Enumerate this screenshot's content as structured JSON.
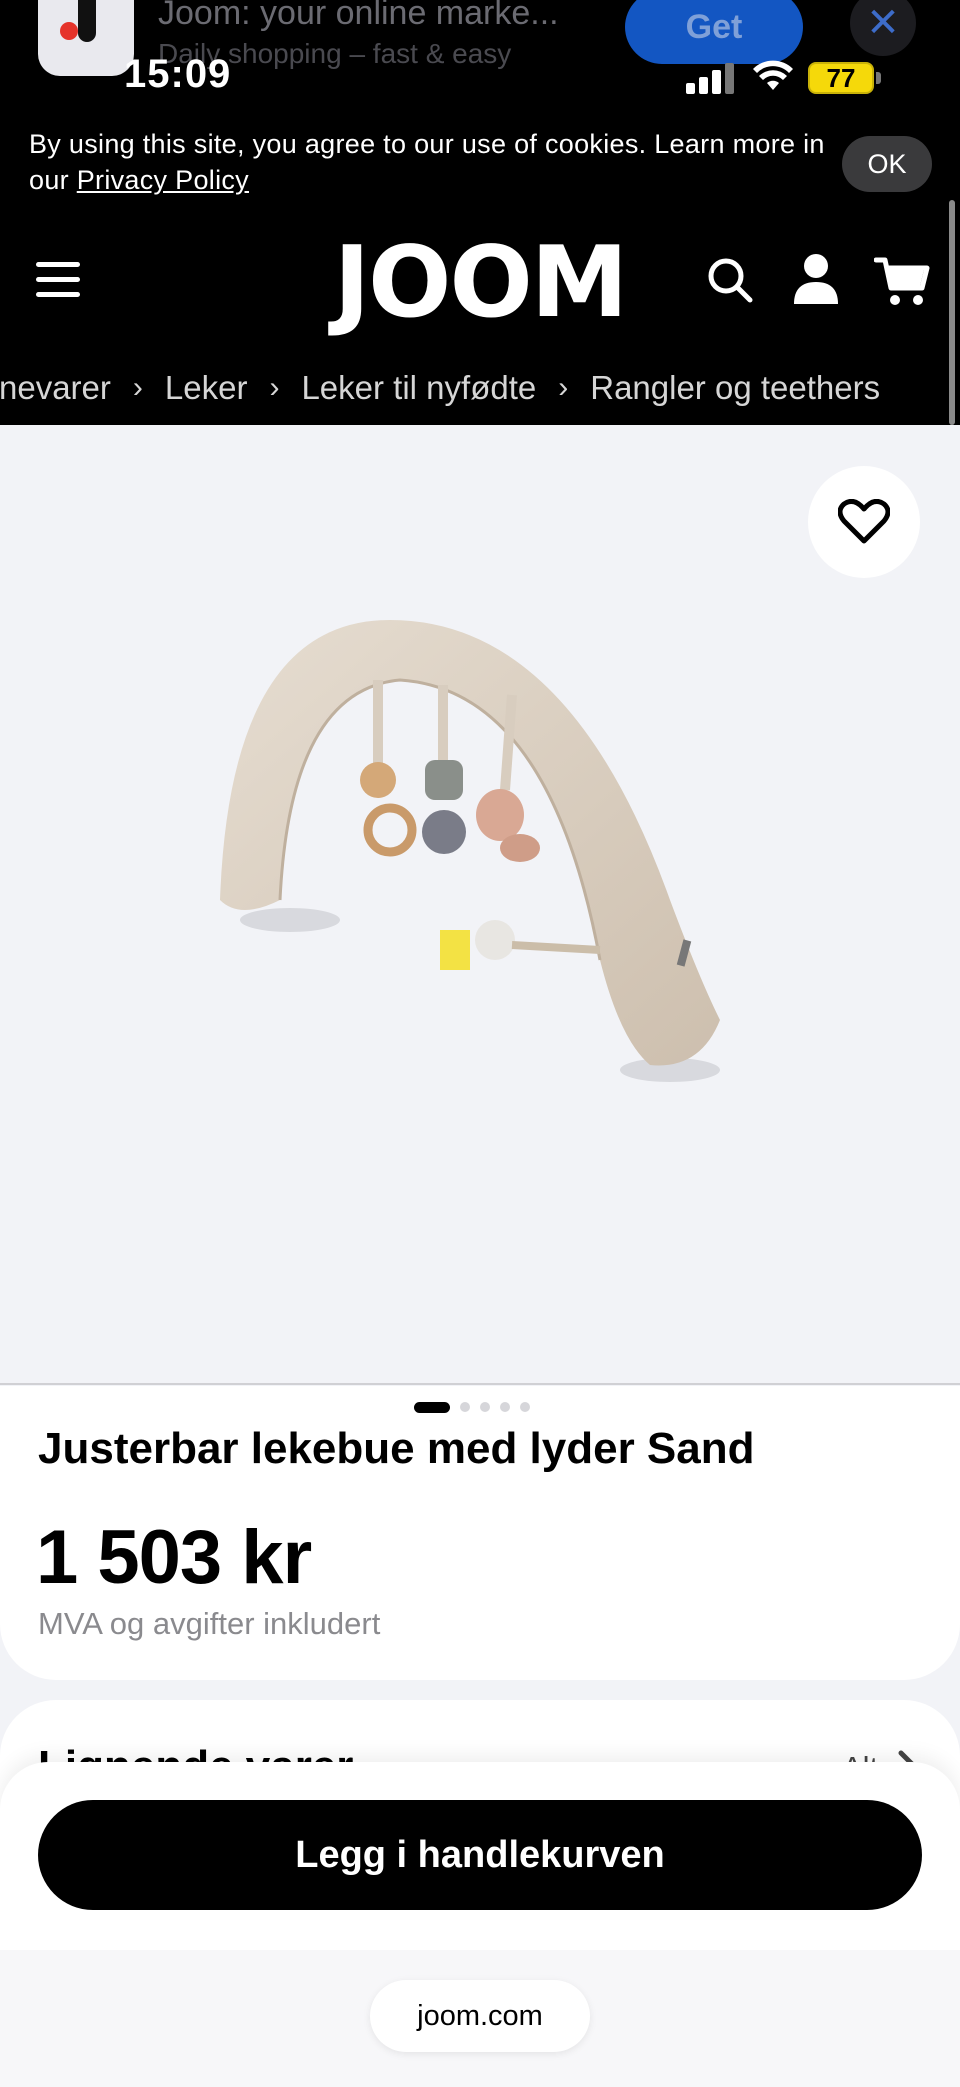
{
  "app_banner": {
    "name": "Joom: your online marke...",
    "subtitle": "Daily shopping – fast & easy",
    "get_label": "Get",
    "close_symbol": "✕"
  },
  "status_bar": {
    "time": "15:09",
    "battery": "77"
  },
  "cookie": {
    "text": "By using this site, you agree to our use of cookies. Learn more in our ",
    "link": "Privacy Policy",
    "ok_label": "OK"
  },
  "header": {
    "logo": "JOOM",
    "icons": [
      "menu-icon",
      "search-icon",
      "user-icon",
      "cart-icon"
    ]
  },
  "breadcrumbs": [
    "rnevarer",
    "Leker",
    "Leker til nyfødte",
    "Rangler og teethers"
  ],
  "gallery": {
    "image_count": 5,
    "active_index": 0
  },
  "product": {
    "title": "Justerbar lekebue med lyder Sand",
    "price": "1 503 kr",
    "vat_note": "MVA og avgifter inkludert"
  },
  "similar": {
    "title": "Lignende varer",
    "all_label": "Alt"
  },
  "actions": {
    "add_to_cart": "Legg i handlekurven"
  },
  "browser": {
    "url": "joom.com"
  },
  "colors": {
    "header_bg": "#000000",
    "accent_blue": "#1356c2",
    "battery": "#f5d90a",
    "page_bg": "#f2f3f7"
  }
}
